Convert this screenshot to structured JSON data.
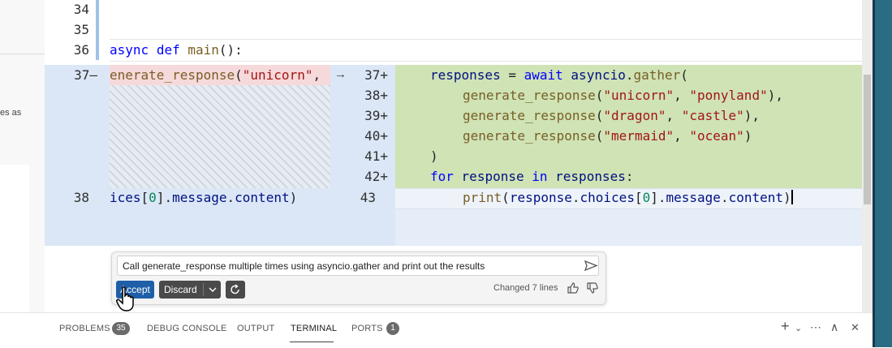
{
  "sidebar": {
    "fragment": "es as"
  },
  "editor": {
    "lines_top": [
      {
        "num": "34"
      },
      {
        "num": "35"
      },
      {
        "num": "36",
        "code": [
          "async",
          "def",
          "main",
          "():"
        ]
      }
    ],
    "left_old": {
      "num1": "37–",
      "code1_fn": "enerate_response",
      "code1_p1": "(",
      "code1_str": "\"unicorn\"",
      "code1_tail": ",",
      "arrow": "→",
      "num2": "38",
      "code2": [
        "ices",
        "[",
        "0",
        "].",
        "message",
        ".",
        "content",
        ")"
      ]
    },
    "right_new": {
      "nums": [
        "37+",
        "38+",
        "39+",
        "40+",
        "41+",
        "42+",
        "43"
      ],
      "l37": {
        "v1": "responses",
        "eq": " = ",
        "kw": "await",
        "mod": "asyncio",
        "dot": ".",
        "fn": "gather",
        "p": "("
      },
      "l38": {
        "fn": "generate_response",
        "p": "(",
        "s1": "\"unicorn\"",
        "c": ", ",
        "s2": "\"ponyland\"",
        "e": "),"
      },
      "l39": {
        "fn": "generate_response",
        "p": "(",
        "s1": "\"dragon\"",
        "c": ", ",
        "s2": "\"castle\"",
        "e": "),"
      },
      "l40": {
        "fn": "generate_response",
        "p": "(",
        "s1": "\"mermaid\"",
        "c": ", ",
        "s2": "\"ocean\"",
        "e": ")"
      },
      "l41": {
        "p": ")"
      },
      "l42": {
        "kw1": "for",
        "v1": "response",
        "kw2": "in",
        "v2": "responses",
        "colon": ":"
      },
      "l43": {
        "fn": "print",
        "p": "(",
        "v1": "response",
        "d1": ".",
        "v2": "choices",
        "b1": "[",
        "n": "0",
        "b2": "].",
        "v3": "message",
        "d2": ".",
        "v4": "content",
        "e": ")"
      }
    }
  },
  "chat": {
    "prompt": "Call generate_response multiple times using asyncio.gather and print out the results",
    "accept_label": "Accept",
    "discard_label": "Discard",
    "changed": "Changed 7 lines",
    "icons": {
      "send": "send-icon",
      "rerun": "rerun-icon",
      "thumb_up": "thumb-up-icon",
      "thumb_down": "thumb-down-icon"
    }
  },
  "panel": {
    "tabs": [
      {
        "label": "PROBLEMS",
        "badge": "35"
      },
      {
        "label": "DEBUG CONSOLE"
      },
      {
        "label": "OUTPUT"
      },
      {
        "label": "TERMINAL",
        "active": true
      },
      {
        "label": "PORTS",
        "badge": "1"
      }
    ],
    "actions": {
      "add": "+",
      "add_chevron": "⌄",
      "more": "⋯",
      "maximize": "∧",
      "close": "✕"
    }
  },
  "colors": {
    "accent": "#1f5fa8",
    "added": "#cfe3b5",
    "removed": "#f6d9da",
    "diff_bg": "#dbe7f6"
  }
}
